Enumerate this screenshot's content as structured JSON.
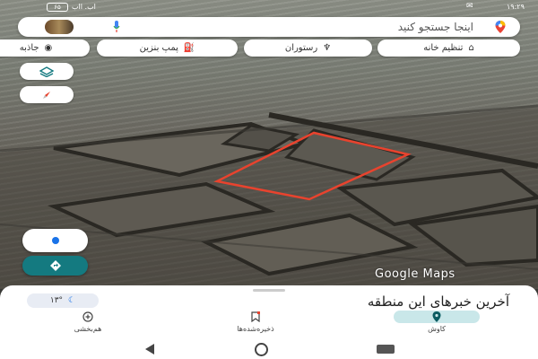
{
  "status_bar": {
    "time": "۱۹:۲۹",
    "battery": "۶۵",
    "signal": "اب. ااب"
  },
  "search": {
    "placeholder": "اینجا جستجو کنید",
    "logo_icon": "maps-pin-icon",
    "mic_icon": "mic-icon"
  },
  "chips": [
    {
      "label": "تنظیم خانه",
      "icon": "home-icon"
    },
    {
      "label": "رستوران",
      "icon": "fork-knife-icon"
    },
    {
      "label": "پمپ بنزین",
      "icon": "gas-pump-icon"
    },
    {
      "label": "جاذبه",
      "icon": "camera-icon"
    }
  ],
  "map": {
    "watermark": "Google Maps",
    "boundary_color": "#e8432e"
  },
  "sheet": {
    "headline": "آخرین خبرهای این منطقه",
    "weather_temp": "۱۳°"
  },
  "bottom_nav": {
    "items": [
      {
        "label": "کاوش",
        "icon": "explore-pin-icon",
        "active": true
      },
      {
        "label": "ذخیره‌شده‌ها",
        "icon": "bookmark-icon",
        "active": false
      },
      {
        "label": "هم‌بخشی",
        "icon": "contribute-icon",
        "active": false
      }
    ]
  },
  "colors": {
    "accent": "#147a80",
    "active_tab": "#c9e7e9"
  }
}
